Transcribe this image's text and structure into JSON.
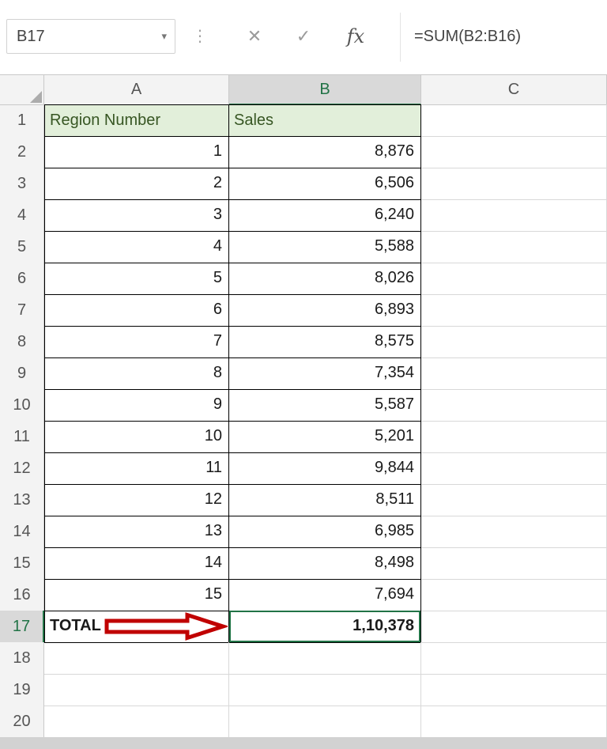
{
  "name_box": {
    "value": "B17",
    "dropdown_icon": "▾"
  },
  "formula_bar": {
    "dots_icon": "⋮",
    "cancel_icon": "✕",
    "enter_icon": "✓",
    "fx_icon": "fx",
    "formula": "=SUM(B2:B16)"
  },
  "colors": {
    "selection_green": "#217346",
    "header_fill_green": "#E2EFDA",
    "header_text_green": "#375623",
    "arrow_red": "#C00000",
    "table_border": "#000000",
    "gridline": "#D8D8D8",
    "header_gray": "#F3F3F3",
    "selected_header_gray": "#D9D9D9"
  },
  "sheet": {
    "columns": [
      "A",
      "B",
      "C"
    ],
    "selected_cell": "B17",
    "selected_column": "B",
    "selected_row": "17",
    "rows": [
      {
        "n": "1",
        "A": "Region Number",
        "B": "Sales",
        "type": "header"
      },
      {
        "n": "2",
        "A": "1",
        "B": "8,876",
        "type": "data"
      },
      {
        "n": "3",
        "A": "2",
        "B": "6,506",
        "type": "data"
      },
      {
        "n": "4",
        "A": "3",
        "B": "6,240",
        "type": "data"
      },
      {
        "n": "5",
        "A": "4",
        "B": "5,588",
        "type": "data"
      },
      {
        "n": "6",
        "A": "5",
        "B": "8,026",
        "type": "data"
      },
      {
        "n": "7",
        "A": "6",
        "B": "6,893",
        "type": "data"
      },
      {
        "n": "8",
        "A": "7",
        "B": "8,575",
        "type": "data"
      },
      {
        "n": "9",
        "A": "8",
        "B": "7,354",
        "type": "data"
      },
      {
        "n": "10",
        "A": "9",
        "B": "5,587",
        "type": "data"
      },
      {
        "n": "11",
        "A": "10",
        "B": "5,201",
        "type": "data"
      },
      {
        "n": "12",
        "A": "11",
        "B": "9,844",
        "type": "data"
      },
      {
        "n": "13",
        "A": "12",
        "B": "8,511",
        "type": "data"
      },
      {
        "n": "14",
        "A": "13",
        "B": "6,985",
        "type": "data"
      },
      {
        "n": "15",
        "A": "14",
        "B": "8,498",
        "type": "data"
      },
      {
        "n": "16",
        "A": "15",
        "B": "7,694",
        "type": "data"
      },
      {
        "n": "17",
        "A": "TOTAL",
        "B": "1,10,378",
        "type": "total"
      },
      {
        "n": "18",
        "A": "",
        "B": "",
        "type": "empty"
      },
      {
        "n": "19",
        "A": "",
        "B": "",
        "type": "empty"
      },
      {
        "n": "20",
        "A": "",
        "B": "",
        "type": "empty"
      }
    ]
  }
}
